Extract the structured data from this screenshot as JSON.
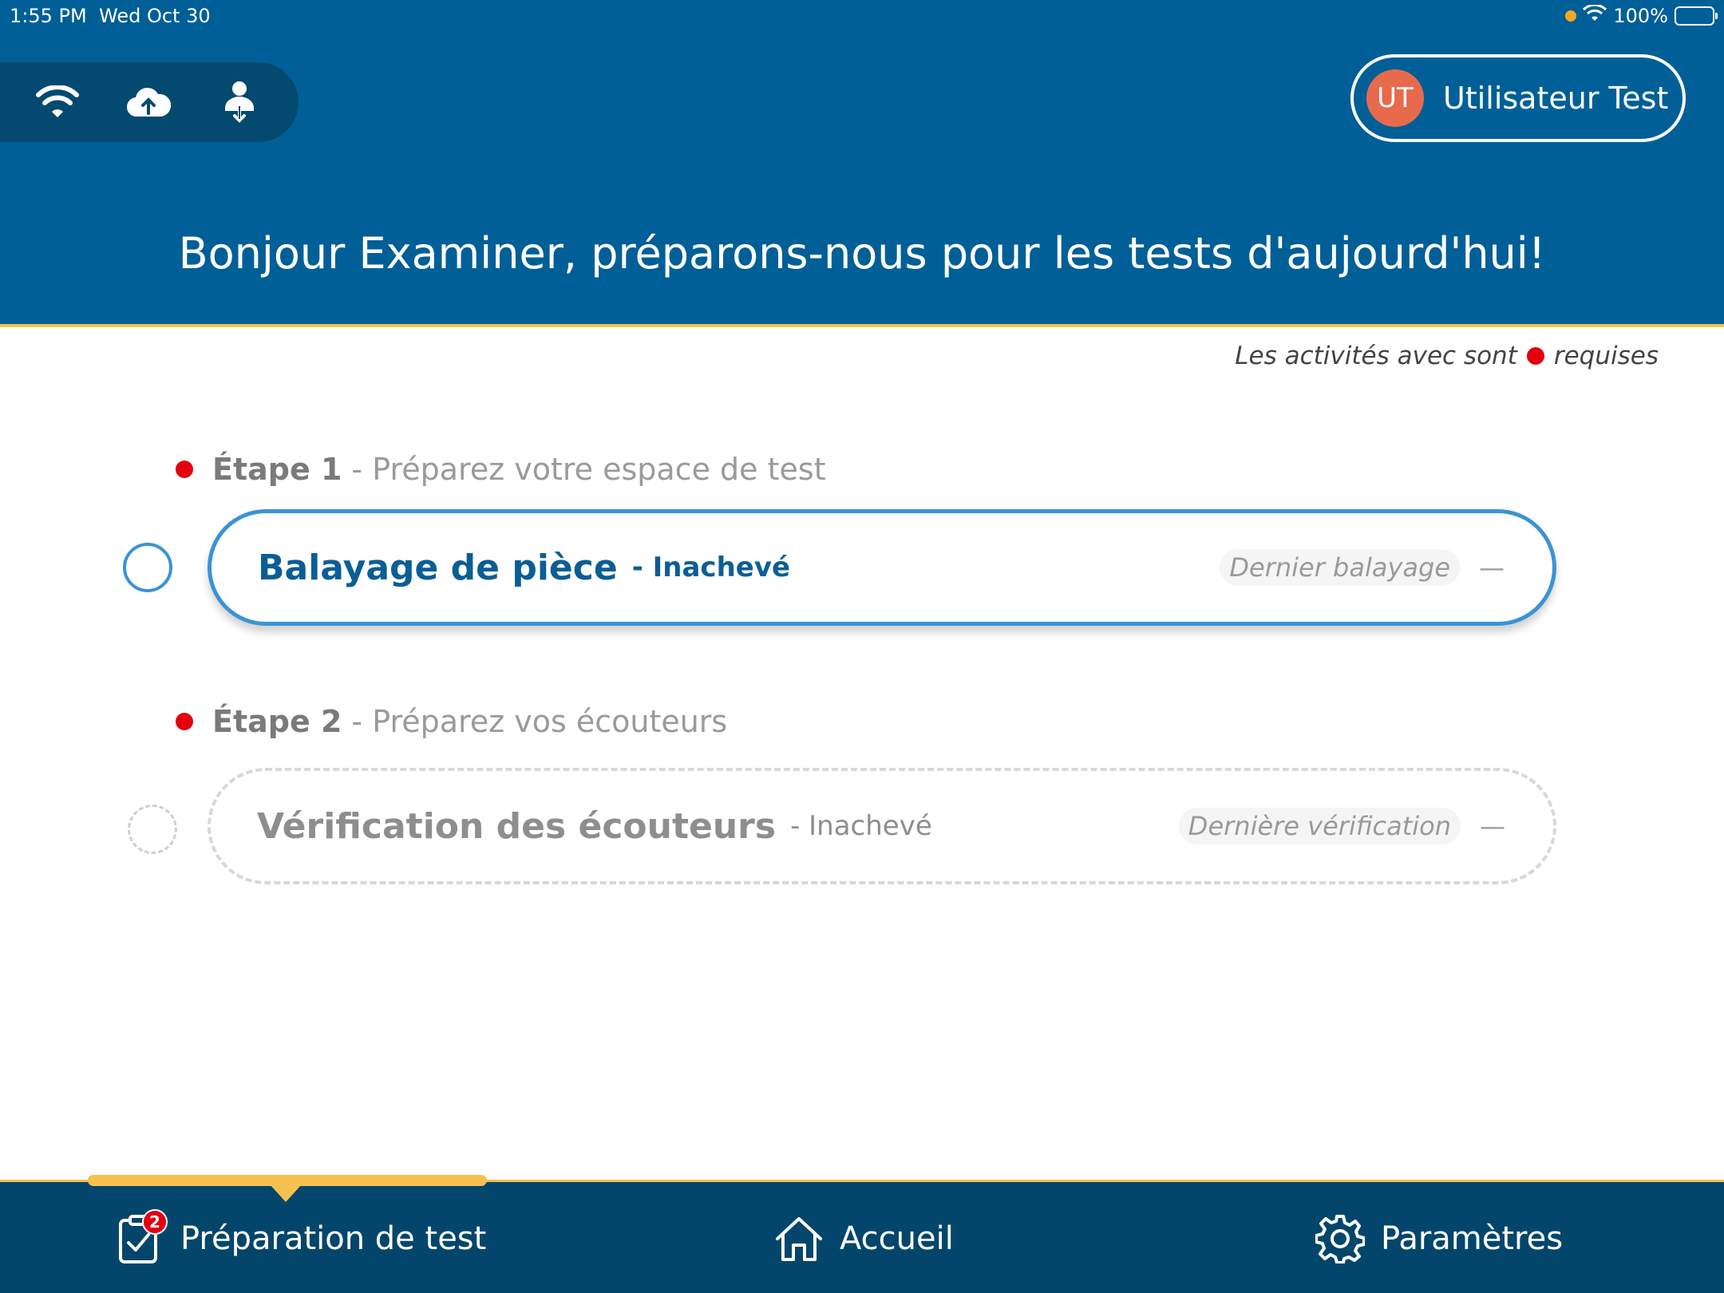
{
  "status_bar": {
    "time": "1:55 PM",
    "date": "Wed Oct 30",
    "battery": "100%"
  },
  "user": {
    "initials": "UT",
    "name": "Utilisateur Test"
  },
  "header": {
    "greeting": "Bonjour Examiner, préparons-nous pour les tests d'aujourd'hui!"
  },
  "required_note": {
    "before": "Les activités avec sont",
    "after": "requises"
  },
  "steps": [
    {
      "number": "Étape 1",
      "description": "- Préparez votre espace de test",
      "task_title": "Balayage de pièce",
      "task_status": "- Inachevé",
      "meta_label": "Dernier balayage",
      "meta_value": "—"
    },
    {
      "number": "Étape 2",
      "description": "- Préparez vos écouteurs",
      "task_title": "Vérification des écouteurs",
      "task_status": "- Inachevé",
      "meta_label": "Dernière vérification",
      "meta_value": "—"
    }
  ],
  "nav": {
    "prep_label": "Préparation de test",
    "prep_badge": "2",
    "home_label": "Accueil",
    "settings_label": "Paramètres"
  },
  "colors": {
    "header_bg": "#005f97",
    "nav_bg": "#04466b",
    "accent_blue": "#3a93d6",
    "required_red": "#e3000f",
    "indicator_yellow": "#f6c04f"
  }
}
